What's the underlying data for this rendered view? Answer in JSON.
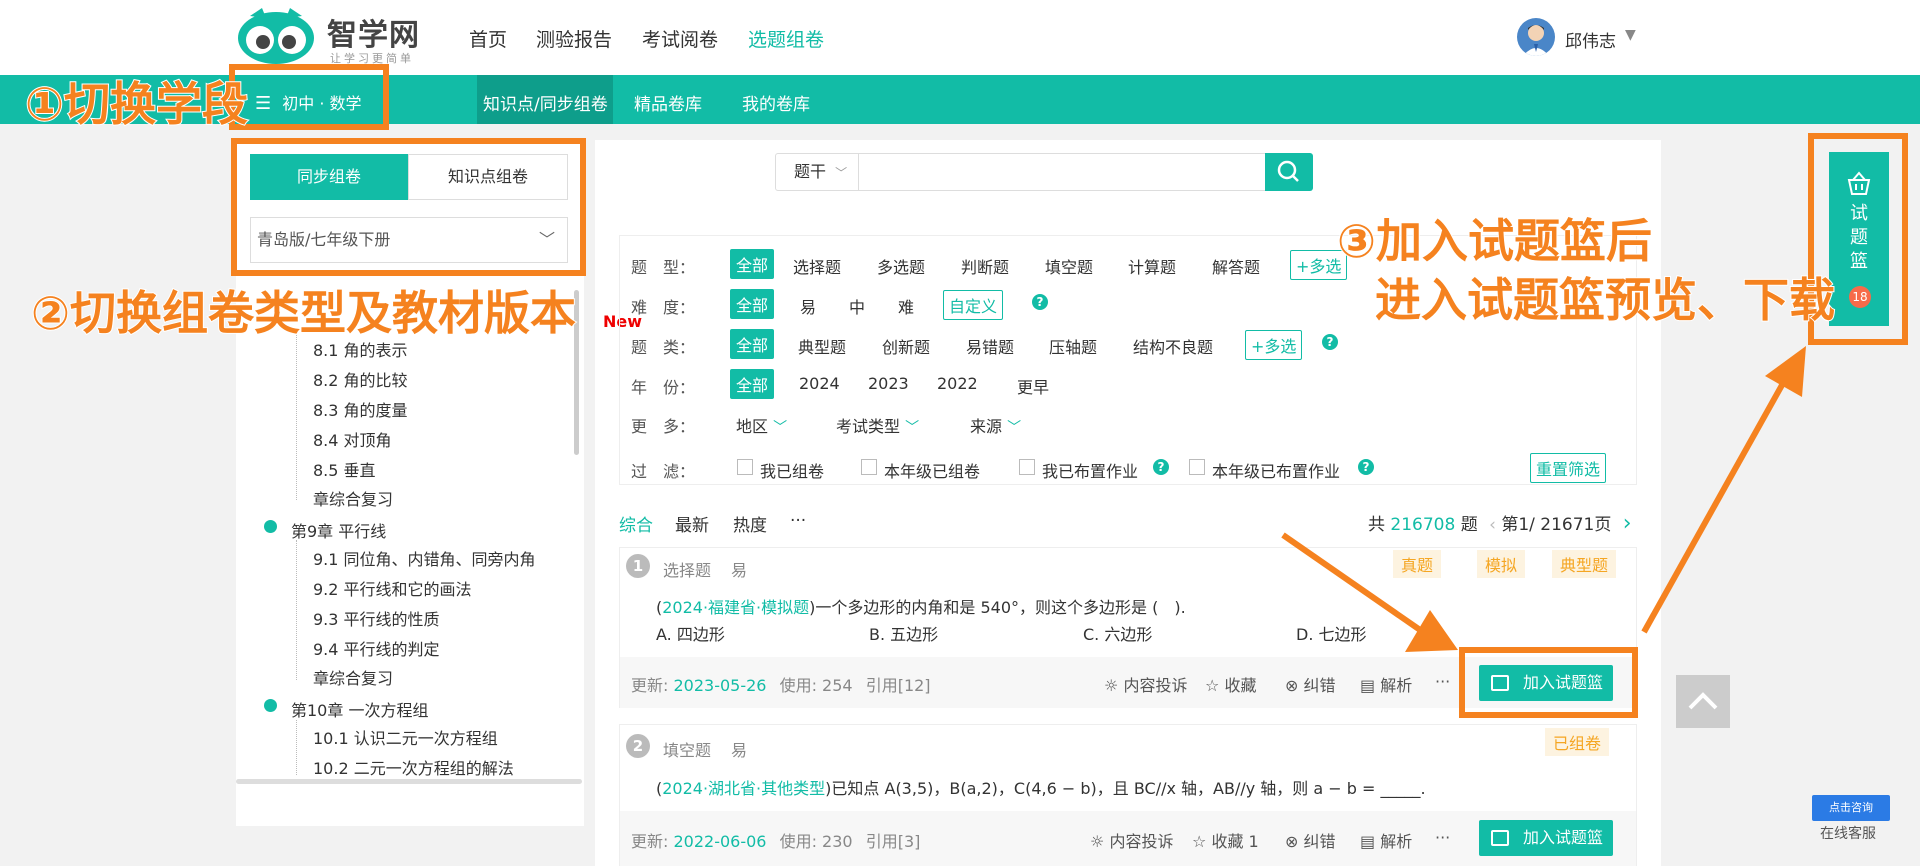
{
  "header": {
    "logo_text": "智学网",
    "logo_slogan": "让学习更简单",
    "nav": [
      "首页",
      "测验报告",
      "考试阅卷",
      "选题组卷"
    ],
    "nav_active": "选题组卷",
    "user_name": "邱伟志"
  },
  "subnav": {
    "grade_subject": "初中 · 数学",
    "tabs": [
      "知识点/同步组卷",
      "精品卷库",
      "我的卷库"
    ]
  },
  "left": {
    "tab_sync": "同步组卷",
    "tab_kp": "知识点组卷",
    "version": "青岛版/七年级下册",
    "tree": {
      "ch8_items": [
        "8.1 角的表示",
        "8.2 角的比较",
        "8.3 角的度量",
        "8.4 对顶角",
        "8.5 垂直",
        "章综合复习"
      ],
      "ch9_title": "第9章 平行线",
      "ch9_items": [
        "9.1 同位角、内错角、同旁内角",
        "9.2 平行线和它的画法",
        "9.3 平行线的性质",
        "9.4 平行线的判定",
        "章综合复习"
      ],
      "ch10_title": "第10章 一次方程组",
      "ch10_items": [
        "10.1 认识二元一次方程组",
        "10.2 二元一次方程组的解法"
      ]
    }
  },
  "search": {
    "selector": "题干"
  },
  "filters": {
    "new_badge": "New",
    "type": {
      "label": "题　型：",
      "all": "全部",
      "options": [
        "选择题",
        "多选题",
        "判断题",
        "填空题",
        "计算题",
        "解答题"
      ],
      "multi": "+多选"
    },
    "difficulty": {
      "label": "难　度：",
      "all": "全部",
      "options": [
        "易",
        "中",
        "难"
      ],
      "custom": "自定义"
    },
    "category": {
      "label": "题　类：",
      "all": "全部",
      "options": [
        "典型题",
        "创新题",
        "易错题",
        "压轴题",
        "结构不良题"
      ],
      "multi": "+多选"
    },
    "year": {
      "label": "年　份：",
      "all": "全部",
      "options": [
        "2024",
        "2023",
        "2022",
        "更早"
      ]
    },
    "more": {
      "label": "更　多：",
      "options": [
        "地区",
        "考试类型",
        "来源"
      ]
    },
    "filter": {
      "label": "过　滤：",
      "options": [
        "我已组卷",
        "本年级已组卷",
        "我已布置作业",
        "本年级已布置作业"
      ],
      "reset": "重置筛选"
    }
  },
  "sort": {
    "options": [
      "综合",
      "最新",
      "热度",
      "···"
    ],
    "total_prefix": "共",
    "total_count": "216708",
    "total_suffix": "题",
    "page": "第1/ 21671页"
  },
  "questions": [
    {
      "num": "1",
      "type": "选择题",
      "level": "易",
      "tags": [
        "真题",
        "模拟",
        "典型题"
      ],
      "source": "2024·福建省·模拟题",
      "stem": "一个多边形的内角和是 540°，则这个多边形是 (　).",
      "choices": [
        "A. 四边形",
        "B. 五边形",
        "C. 六边形",
        "D. 七边形"
      ],
      "update_label": "更新:",
      "update": "2023-05-26",
      "usage": "使用: 254",
      "cite": "引用[12]",
      "actions": [
        "内容投诉",
        "收藏",
        "纠错",
        "解析",
        "···"
      ],
      "add": "加入试题篮"
    },
    {
      "num": "2",
      "type": "填空题",
      "level": "易",
      "tags": [
        "已组卷"
      ],
      "source": "2024·湖北省·其他类型",
      "stem": "已知点 A(3,5)，B(a,2)，C(4,6 − b)，且 BC//x 轴，AB//y 轴，则 a − b = _____.",
      "update_label": "更新:",
      "update": "2022-06-06",
      "usage": "使用: 230",
      "cite": "引用[3]",
      "actions": [
        "内容投诉",
        "收藏 1",
        "纠错",
        "解析",
        "···"
      ],
      "add": "加入试题篮"
    }
  ],
  "basket": {
    "label": "试题篮",
    "count": "18"
  },
  "service": {
    "consult": "点击咨询",
    "online": "在线客服"
  },
  "annotations": {
    "a1": "①切换学段",
    "a2": "②切换组卷类型及教材版本",
    "a3_line1": "③加入试题篮后",
    "a3_line2": "进入试题篮预览、下载"
  },
  "colors": {
    "accent": "#12bca6",
    "annotation": "#f5821f",
    "tag": "#f5a623"
  }
}
